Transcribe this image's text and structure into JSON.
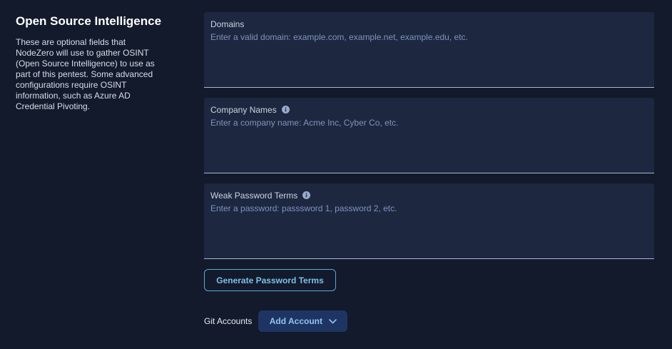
{
  "intro": {
    "title": "Open Source Intelligence",
    "description": "These are optional fields that NodeZero will use to gather OSINT (Open Source Intelligence) to use as part of this pentest. Some advanced configurations require OSINT information, such as Azure AD Credential Pivoting."
  },
  "fields": {
    "domains": {
      "label": "Domains",
      "placeholder": "Enter a valid domain: example.com, example.net, example.edu, etc.",
      "value": ""
    },
    "company_names": {
      "label": "Company Names",
      "placeholder": "Enter a company name: Acme Inc, Cyber Co, etc.",
      "value": ""
    },
    "weak_password_terms": {
      "label": "Weak Password Terms",
      "placeholder": "Enter a password: passsword 1, password 2, etc.",
      "value": ""
    }
  },
  "actions": {
    "generate_password_terms": "Generate Password Terms"
  },
  "git": {
    "label": "Git Accounts",
    "add_account": "Add Account"
  },
  "icons": {
    "info": "info-icon",
    "chevron": "chevron-down-icon"
  },
  "colors": {
    "background": "#121a2b",
    "field_background": "#1d2840",
    "accent": "#5fa8d8",
    "button_fill": "#1e3563"
  }
}
